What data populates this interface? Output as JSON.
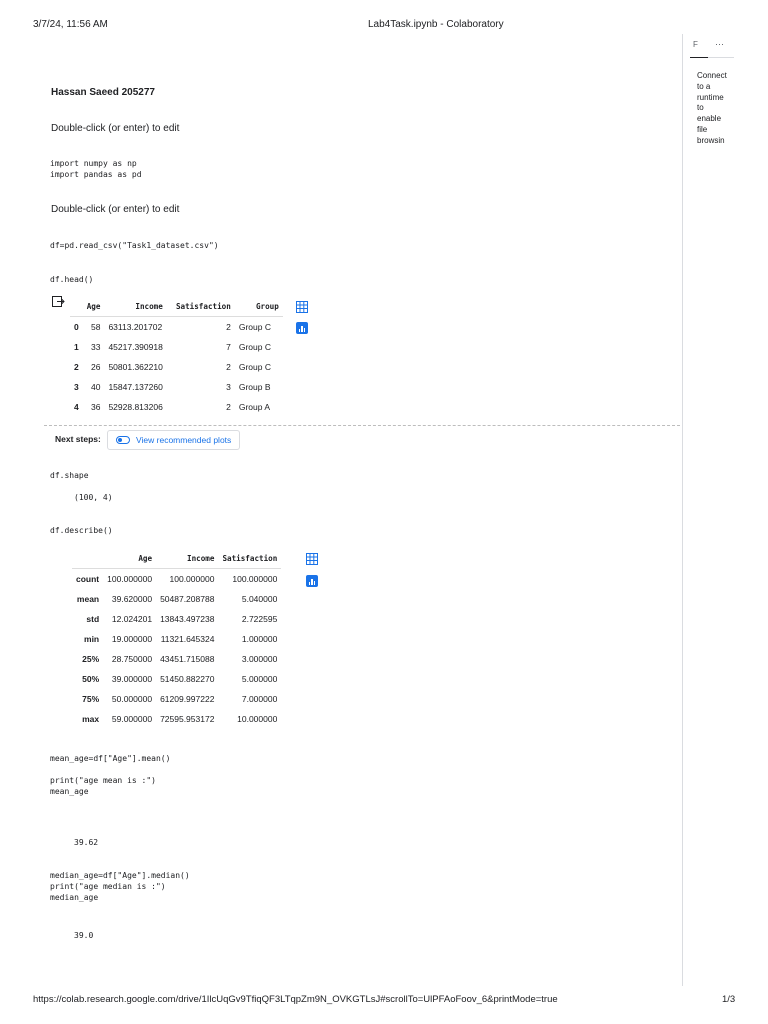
{
  "print_header": {
    "datetime": "3/7/24, 11:56 AM",
    "title": "Lab4Task.ipynb - Colaboratory"
  },
  "print_footer": {
    "url": "https://colab.research.google.com/drive/1IlcUqGv9TfiqQF3LTqpZm9N_OVKGTLsJ#scrollTo=UlPFAoFoov_6&printMode=true",
    "page": "1/3"
  },
  "side_panel": {
    "tab_label": "F",
    "more_label": "⋯",
    "message_lines": [
      "Connect",
      "to a",
      "runtime",
      "to",
      "enable",
      "file",
      "browsin"
    ]
  },
  "cells": {
    "title_text": "Hassan Saeed 205277",
    "md_placeholder_1": "Double-click (or enter) to edit",
    "code_imports": "import numpy as np\nimport pandas as pd",
    "md_placeholder_2": "Double-click (or enter) to edit",
    "code_read_csv": "df=pd.read_csv(\"Task1_dataset.csv\")",
    "code_head": "df.head()",
    "head_table": {
      "columns": [
        "Age",
        "Income",
        "Satisfaction",
        "Group"
      ],
      "rows": [
        {
          "index": "0",
          "Age": "58",
          "Income": "63113.201702",
          "Satisfaction": "2",
          "Group": "Group C"
        },
        {
          "index": "1",
          "Age": "33",
          "Income": "45217.390918",
          "Satisfaction": "7",
          "Group": "Group C"
        },
        {
          "index": "2",
          "Age": "26",
          "Income": "50801.362210",
          "Satisfaction": "2",
          "Group": "Group C"
        },
        {
          "index": "3",
          "Age": "40",
          "Income": "15847.137260",
          "Satisfaction": "3",
          "Group": "Group B"
        },
        {
          "index": "4",
          "Age": "36",
          "Income": "52928.813206",
          "Satisfaction": "2",
          "Group": "Group A"
        }
      ]
    },
    "next_steps_label": "Next steps:",
    "view_plots_label": "View recommended plots",
    "code_shape": "df.shape",
    "shape_output": "(100, 4)",
    "code_describe": "df.describe()",
    "describe_table": {
      "columns": [
        "Age",
        "Income",
        "Satisfaction"
      ],
      "rows": [
        {
          "index": "count",
          "Age": "100.000000",
          "Income": "100.000000",
          "Satisfaction": "100.000000"
        },
        {
          "index": "mean",
          "Age": "39.620000",
          "Income": "50487.208788",
          "Satisfaction": "5.040000"
        },
        {
          "index": "std",
          "Age": "12.024201",
          "Income": "13843.497238",
          "Satisfaction": "2.722595"
        },
        {
          "index": "min",
          "Age": "19.000000",
          "Income": "11321.645324",
          "Satisfaction": "1.000000"
        },
        {
          "index": "25%",
          "Age": "28.750000",
          "Income": "43451.715088",
          "Satisfaction": "3.000000"
        },
        {
          "index": "50%",
          "Age": "39.000000",
          "Income": "51450.882270",
          "Satisfaction": "5.000000"
        },
        {
          "index": "75%",
          "Age": "50.000000",
          "Income": "61209.997222",
          "Satisfaction": "7.000000"
        },
        {
          "index": "max",
          "Age": "59.000000",
          "Income": "72595.953172",
          "Satisfaction": "10.000000"
        }
      ]
    },
    "code_mean": "mean_age=df[\"Age\"].mean()\n\nprint(\"age mean is :\")\nmean_age",
    "mean_output": "39.62",
    "code_median": "median_age=df[\"Age\"].median()\nprint(\"age median is :\")\nmedian_age",
    "median_output": "39.0"
  },
  "colors": {
    "accent": "#1a73e8",
    "divider": "#dadce0"
  }
}
